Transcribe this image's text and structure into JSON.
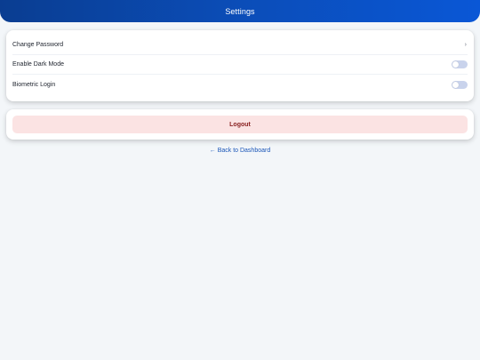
{
  "header": {
    "title": "Settings"
  },
  "settings": {
    "rows": [
      {
        "label": "Change Password",
        "control": "chevron",
        "icon": "chevron-right-icon"
      },
      {
        "label": "Enable Dark Mode",
        "control": "toggle",
        "enabled": false
      },
      {
        "label": "Biometric Login",
        "control": "toggle",
        "enabled": false
      }
    ],
    "chevron_glyph": "›"
  },
  "logout": {
    "label": "Logout"
  },
  "back_link": {
    "label": "← Back to Dashboard"
  },
  "colors": {
    "header_gradient_start": "#0a3d91",
    "header_gradient_end": "#0a57d6",
    "logout_bg": "#fbe3e3",
    "logout_text": "#8a2121",
    "link": "#1a56b8",
    "toggle_off": "#c9d3ec"
  }
}
